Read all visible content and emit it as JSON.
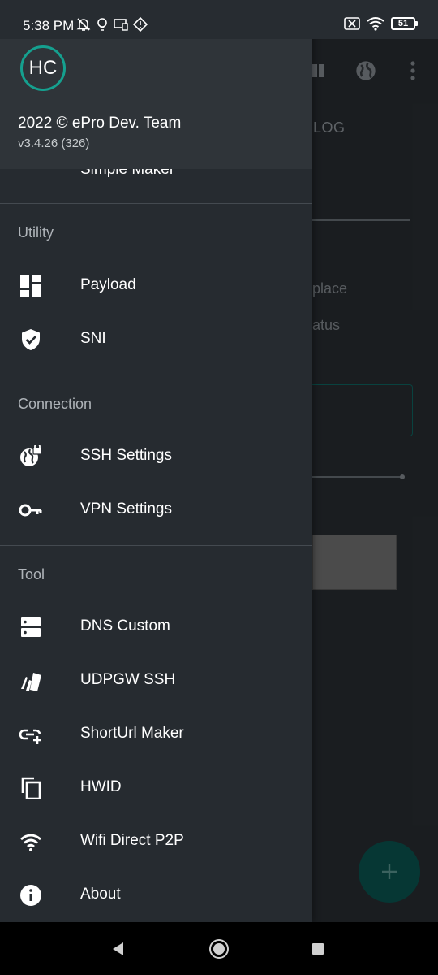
{
  "status_bar": {
    "time": "5:38 PM",
    "battery_level": "51",
    "left_icons": [
      "bell-off-icon",
      "lightbulb-icon",
      "cast-icon",
      "location-diamond-icon"
    ],
    "right_icons": [
      "sim-off-icon",
      "wifi-icon",
      "battery-icon"
    ]
  },
  "background_app": {
    "tab_label": "LOG",
    "text_partial_1": "place",
    "text_partial_2": "atus",
    "fab_label": "+",
    "accent_color": "#0b5a55"
  },
  "drawer": {
    "logo_text": "HC",
    "copyright": "2022 © ePro Dev. Team",
    "version": "v3.4.26 (326)",
    "partial_item_label": "Simple Maker",
    "sections": [
      {
        "title": "Utility",
        "items": [
          {
            "label": "Payload",
            "icon": "dashboard-icon"
          },
          {
            "label": "SNI",
            "icon": "shield-check-icon"
          }
        ]
      },
      {
        "title": "Connection",
        "items": [
          {
            "label": "SSH Settings",
            "icon": "globe-lock-icon"
          },
          {
            "label": "VPN Settings",
            "icon": "key-icon"
          }
        ]
      },
      {
        "title": "Tool",
        "items": [
          {
            "label": "DNS Custom",
            "icon": "dns-icon"
          },
          {
            "label": "UDPGW SSH",
            "icon": "swatch-icon"
          },
          {
            "label": "ShortUrl Maker",
            "icon": "link-plus-icon"
          },
          {
            "label": "HWID",
            "icon": "copy-icon"
          },
          {
            "label": "Wifi Direct P2P",
            "icon": "wifi-icon"
          },
          {
            "label": "About",
            "icon": "info-icon"
          }
        ]
      }
    ]
  },
  "colors": {
    "drawer_bg": "#262b30",
    "header_bg": "#2f3439",
    "logo_ring": "#15a08f",
    "section_title": "#aeb3b8"
  }
}
